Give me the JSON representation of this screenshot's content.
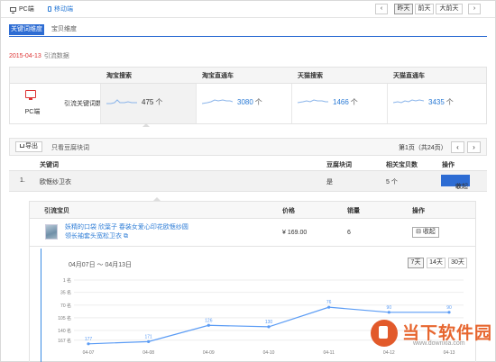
{
  "top": {
    "device_tabs": [
      {
        "label": "PC端",
        "icon": "monitor-icon"
      },
      {
        "label": "移动端",
        "icon": "phone-icon"
      }
    ],
    "prev_label": "‹",
    "range_buttons": [
      "昨天",
      "前天",
      "大前天"
    ],
    "next_label": "›"
  },
  "dimension_tabs": [
    "关键词维度",
    "宝贝维度"
  ],
  "date_note": {
    "date": "2015-04-13",
    "text": "引流数据"
  },
  "summary": {
    "columns": [
      "淘宝搜索",
      "淘宝直通车",
      "天猫搜索",
      "天猫直通车"
    ],
    "device_label": "PC端",
    "row_label": "引流关键词数",
    "values": [
      "475",
      "3080",
      "1466",
      "3435"
    ],
    "unit": "个"
  },
  "keywords_toolbar": {
    "export_label": "导出",
    "filter_label": "只看豆腐块词",
    "page_info": "第1页（共24页）",
    "prev_label": "‹",
    "next_label": "›"
  },
  "keyword_table": {
    "headers": [
      "关键词",
      "豆腐块词",
      "相关宝贝数",
      "操作"
    ],
    "rows": [
      {
        "index": "1.",
        "keyword": "欧惬纱卫衣",
        "tofu": "是",
        "count": "5 个",
        "action": "收起"
      }
    ]
  },
  "detail": {
    "headers": [
      "引流宝贝",
      "价格",
      "销量",
      "操作"
    ],
    "product": {
      "title": "妖精的口袋 欣葉子 春装女爱心印花欧惬纱圆领长袖套头宽松卫衣",
      "price": "¥ 169.00",
      "sales": "6",
      "action": "收起"
    },
    "range_label": "04月07日 ～ 04月13日",
    "range_buttons": [
      "7天",
      "14天",
      "30天"
    ]
  },
  "chart_data": {
    "type": "line",
    "x": [
      "04-07",
      "04-08",
      "04-09",
      "04-10",
      "04-11",
      "04-12",
      "04-13"
    ],
    "series": [
      {
        "values": [
          177,
          171,
          126,
          130,
          76,
          90,
          90
        ]
      }
    ],
    "y_ticks": [
      "1 名",
      "35 名",
      "70 名",
      "105 名",
      "140 名",
      "167 名"
    ],
    "y_reversed": true,
    "ylim": [
      1,
      180
    ],
    "point_labels": [
      "177",
      "171",
      "126",
      "130",
      "76",
      "90",
      "90"
    ],
    "color": "#5b9cf5"
  },
  "watermark": {
    "text": "当下软件园",
    "url": "www.downxia.com"
  }
}
